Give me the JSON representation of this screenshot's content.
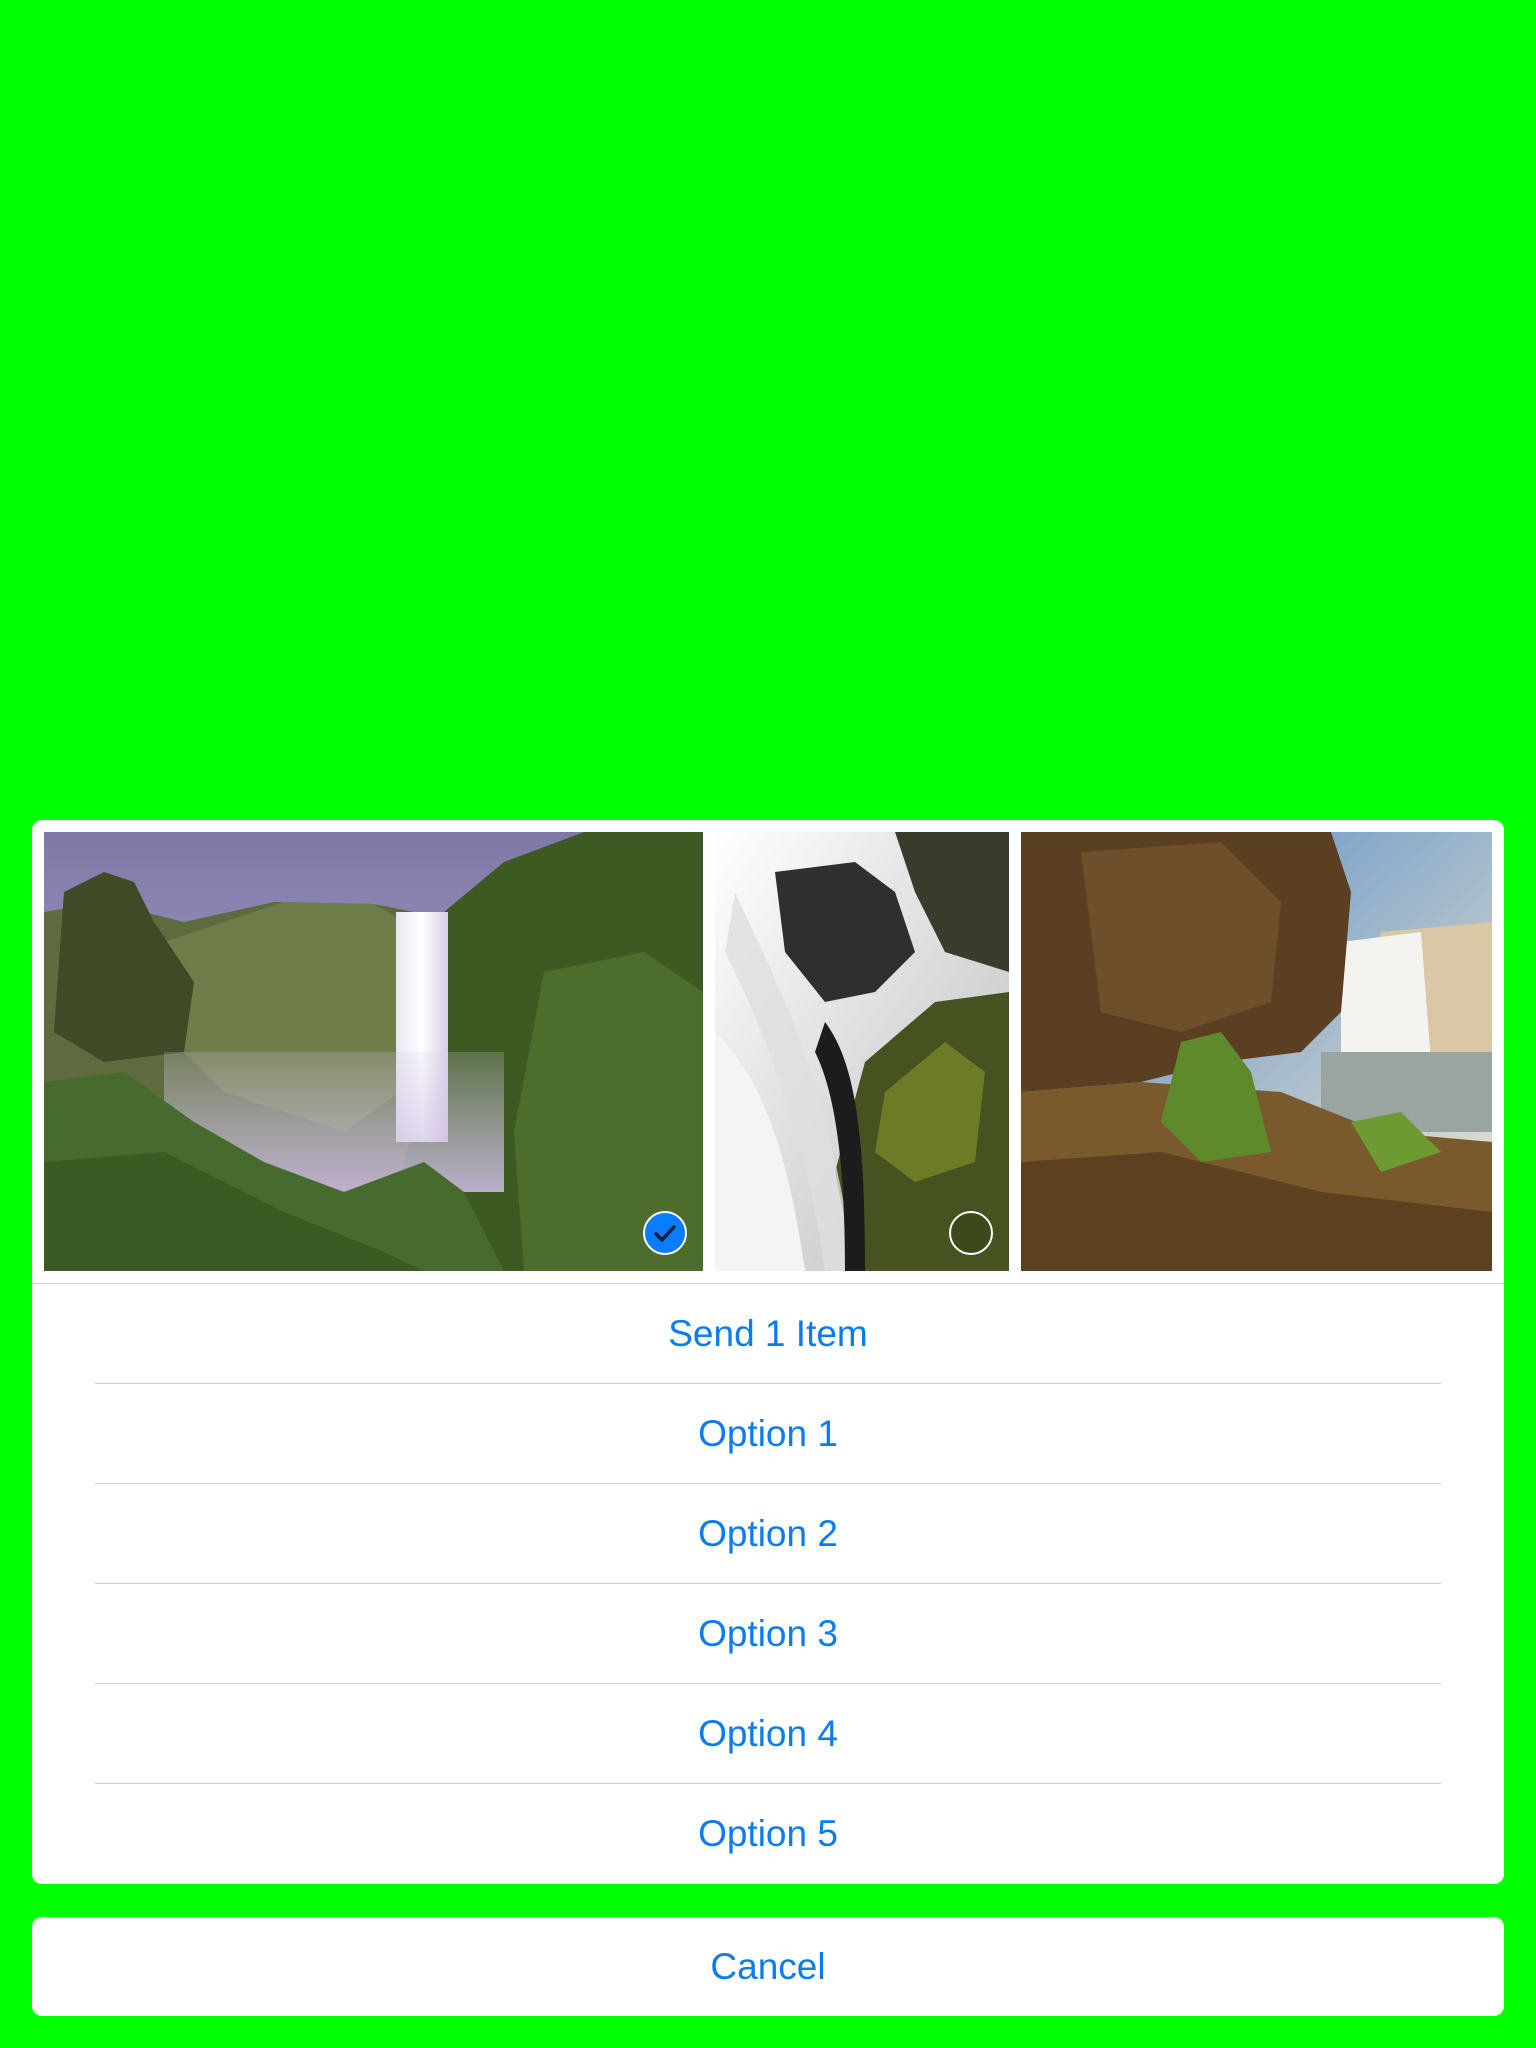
{
  "colors": {
    "background": "#00ff00",
    "sheet": "#ffffff",
    "accent": "#0a7cf0",
    "separator": "#cfcfcf"
  },
  "photos": [
    {
      "subject": "waterfall-canyon-mist",
      "selected": true,
      "selection_icon": "checkmark-circle-icon"
    },
    {
      "subject": "waterfall-rapids-rocks",
      "selected": false,
      "selection_icon": "empty-circle-icon"
    },
    {
      "subject": "waterfall-cliff-plants",
      "selected": false
    }
  ],
  "actions": [
    {
      "label": "Send 1 Item"
    },
    {
      "label": "Option 1"
    },
    {
      "label": "Option 2"
    },
    {
      "label": "Option 3"
    },
    {
      "label": "Option 4"
    },
    {
      "label": "Option 5"
    }
  ],
  "cancel": {
    "label": "Cancel"
  }
}
